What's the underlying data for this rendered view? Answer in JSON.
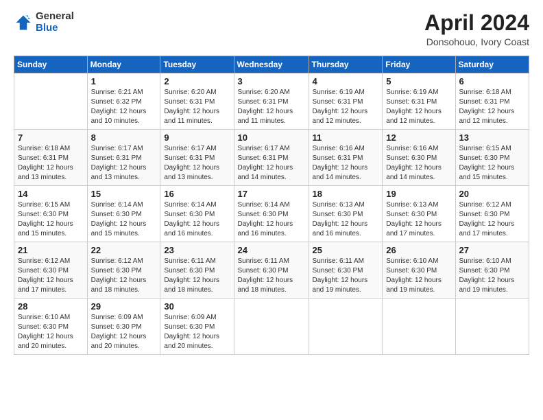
{
  "logo": {
    "general": "General",
    "blue": "Blue"
  },
  "header": {
    "month_year": "April 2024",
    "location": "Donsohouo, Ivory Coast"
  },
  "weekdays": [
    "Sunday",
    "Monday",
    "Tuesday",
    "Wednesday",
    "Thursday",
    "Friday",
    "Saturday"
  ],
  "weeks": [
    [
      {
        "day": "",
        "info": ""
      },
      {
        "day": "1",
        "info": "Sunrise: 6:21 AM\nSunset: 6:32 PM\nDaylight: 12 hours\nand 10 minutes."
      },
      {
        "day": "2",
        "info": "Sunrise: 6:20 AM\nSunset: 6:31 PM\nDaylight: 12 hours\nand 11 minutes."
      },
      {
        "day": "3",
        "info": "Sunrise: 6:20 AM\nSunset: 6:31 PM\nDaylight: 12 hours\nand 11 minutes."
      },
      {
        "day": "4",
        "info": "Sunrise: 6:19 AM\nSunset: 6:31 PM\nDaylight: 12 hours\nand 12 minutes."
      },
      {
        "day": "5",
        "info": "Sunrise: 6:19 AM\nSunset: 6:31 PM\nDaylight: 12 hours\nand 12 minutes."
      },
      {
        "day": "6",
        "info": "Sunrise: 6:18 AM\nSunset: 6:31 PM\nDaylight: 12 hours\nand 12 minutes."
      }
    ],
    [
      {
        "day": "7",
        "info": "Sunrise: 6:18 AM\nSunset: 6:31 PM\nDaylight: 12 hours\nand 13 minutes."
      },
      {
        "day": "8",
        "info": "Sunrise: 6:17 AM\nSunset: 6:31 PM\nDaylight: 12 hours\nand 13 minutes."
      },
      {
        "day": "9",
        "info": "Sunrise: 6:17 AM\nSunset: 6:31 PM\nDaylight: 12 hours\nand 13 minutes."
      },
      {
        "day": "10",
        "info": "Sunrise: 6:17 AM\nSunset: 6:31 PM\nDaylight: 12 hours\nand 14 minutes."
      },
      {
        "day": "11",
        "info": "Sunrise: 6:16 AM\nSunset: 6:31 PM\nDaylight: 12 hours\nand 14 minutes."
      },
      {
        "day": "12",
        "info": "Sunrise: 6:16 AM\nSunset: 6:30 PM\nDaylight: 12 hours\nand 14 minutes."
      },
      {
        "day": "13",
        "info": "Sunrise: 6:15 AM\nSunset: 6:30 PM\nDaylight: 12 hours\nand 15 minutes."
      }
    ],
    [
      {
        "day": "14",
        "info": "Sunrise: 6:15 AM\nSunset: 6:30 PM\nDaylight: 12 hours\nand 15 minutes."
      },
      {
        "day": "15",
        "info": "Sunrise: 6:14 AM\nSunset: 6:30 PM\nDaylight: 12 hours\nand 15 minutes."
      },
      {
        "day": "16",
        "info": "Sunrise: 6:14 AM\nSunset: 6:30 PM\nDaylight: 12 hours\nand 16 minutes."
      },
      {
        "day": "17",
        "info": "Sunrise: 6:14 AM\nSunset: 6:30 PM\nDaylight: 12 hours\nand 16 minutes."
      },
      {
        "day": "18",
        "info": "Sunrise: 6:13 AM\nSunset: 6:30 PM\nDaylight: 12 hours\nand 16 minutes."
      },
      {
        "day": "19",
        "info": "Sunrise: 6:13 AM\nSunset: 6:30 PM\nDaylight: 12 hours\nand 17 minutes."
      },
      {
        "day": "20",
        "info": "Sunrise: 6:12 AM\nSunset: 6:30 PM\nDaylight: 12 hours\nand 17 minutes."
      }
    ],
    [
      {
        "day": "21",
        "info": "Sunrise: 6:12 AM\nSunset: 6:30 PM\nDaylight: 12 hours\nand 17 minutes."
      },
      {
        "day": "22",
        "info": "Sunrise: 6:12 AM\nSunset: 6:30 PM\nDaylight: 12 hours\nand 18 minutes."
      },
      {
        "day": "23",
        "info": "Sunrise: 6:11 AM\nSunset: 6:30 PM\nDaylight: 12 hours\nand 18 minutes."
      },
      {
        "day": "24",
        "info": "Sunrise: 6:11 AM\nSunset: 6:30 PM\nDaylight: 12 hours\nand 18 minutes."
      },
      {
        "day": "25",
        "info": "Sunrise: 6:11 AM\nSunset: 6:30 PM\nDaylight: 12 hours\nand 19 minutes."
      },
      {
        "day": "26",
        "info": "Sunrise: 6:10 AM\nSunset: 6:30 PM\nDaylight: 12 hours\nand 19 minutes."
      },
      {
        "day": "27",
        "info": "Sunrise: 6:10 AM\nSunset: 6:30 PM\nDaylight: 12 hours\nand 19 minutes."
      }
    ],
    [
      {
        "day": "28",
        "info": "Sunrise: 6:10 AM\nSunset: 6:30 PM\nDaylight: 12 hours\nand 20 minutes."
      },
      {
        "day": "29",
        "info": "Sunrise: 6:09 AM\nSunset: 6:30 PM\nDaylight: 12 hours\nand 20 minutes."
      },
      {
        "day": "30",
        "info": "Sunrise: 6:09 AM\nSunset: 6:30 PM\nDaylight: 12 hours\nand 20 minutes."
      },
      {
        "day": "",
        "info": ""
      },
      {
        "day": "",
        "info": ""
      },
      {
        "day": "",
        "info": ""
      },
      {
        "day": "",
        "info": ""
      }
    ]
  ]
}
